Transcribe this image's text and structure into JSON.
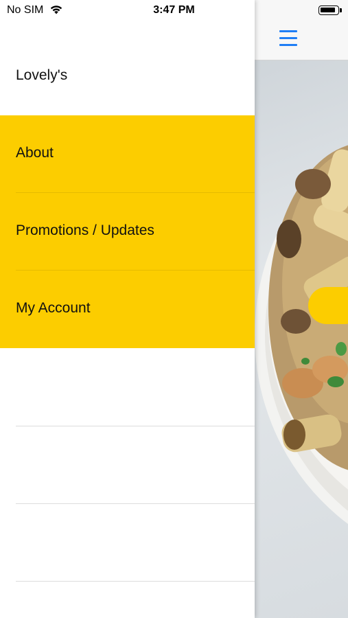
{
  "status_bar": {
    "carrier": "No SIM",
    "time": "3:47 PM",
    "wifi_icon": "wifi-icon",
    "battery_icon": "battery-icon"
  },
  "drawer": {
    "title": "Lovely's",
    "items": [
      {
        "label": "About"
      },
      {
        "label": "Promotions / Updates"
      },
      {
        "label": "My Account"
      }
    ]
  },
  "content": {
    "menu_icon": "hamburger-menu-icon",
    "hero_image": "pasta-bowl-photo"
  },
  "colors": {
    "accent_yellow": "#fccd00",
    "nav_blue": "#1f7ef5"
  }
}
